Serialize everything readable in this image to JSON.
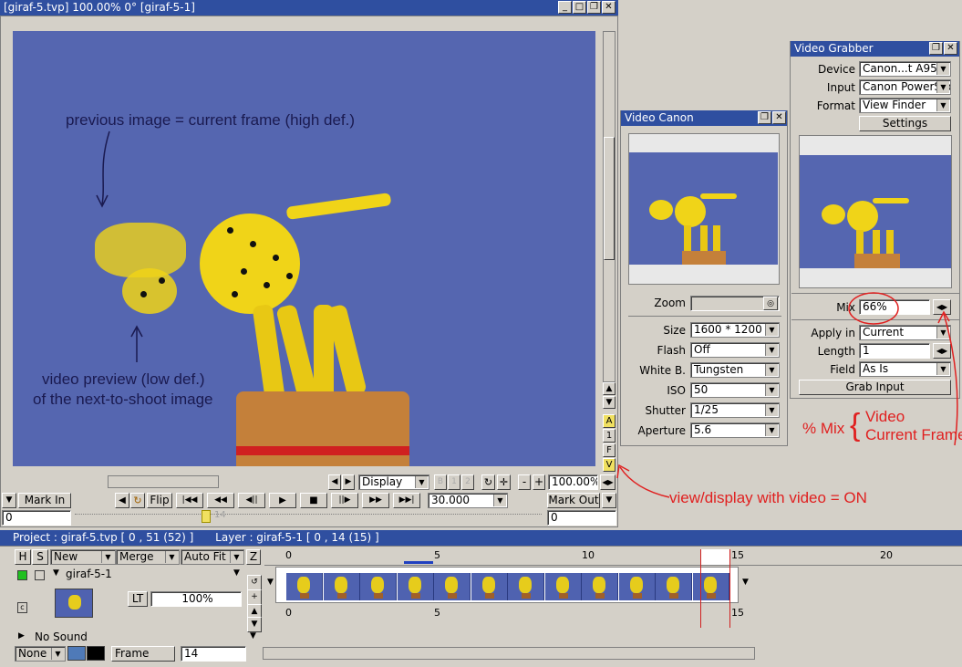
{
  "main_window": {
    "title": "[giraf-5.tvp]  100.00%   0°  [giraf-5-1]",
    "display_label": "Display",
    "zoom": "100.00%",
    "fps": "30.000",
    "mark_in_label": "Mark In",
    "mark_out_label": "Mark Out",
    "flip_label": "Flip",
    "mark_in_value": "0",
    "mark_out_value": "0",
    "current_frame_marker": "14",
    "side_buttons": [
      "A",
      "1",
      "F",
      "V"
    ]
  },
  "annotations": {
    "previous_image": "previous image = current frame (high def.)",
    "video_preview_line1": "video preview (low def.)",
    "video_preview_line2": "of the next-to-shoot image",
    "view_display": "view/display with video = ON",
    "mix_label": "% Mix",
    "brace": "{",
    "video_line1": "Video",
    "video_line2": "Current Frame"
  },
  "video_canon": {
    "title": "Video Canon",
    "zoom_label": "Zoom",
    "size_label": "Size",
    "size_value": "1600 * 1200",
    "flash_label": "Flash",
    "flash_value": "Off",
    "white_label": "White B.",
    "white_value": "Tungsten",
    "iso_label": "ISO",
    "iso_value": "50",
    "shutter_label": "Shutter",
    "shutter_value": "1/25",
    "aperture_label": "Aperture",
    "aperture_value": "5.6"
  },
  "video_grabber": {
    "title": "Video Grabber",
    "device_label": "Device",
    "device_value": "Canon...t A95",
    "input_label": "Input",
    "input_value": "Canon PowerSho",
    "format_label": "Format",
    "format_value": "View Finder",
    "settings_label": "Settings",
    "mix_label": "Mix",
    "mix_value": "66%",
    "apply_label": "Apply in",
    "apply_value": "Current",
    "length_label": "Length",
    "length_value": "1",
    "field_label": "Field",
    "field_value": "As Is",
    "grab_label": "Grab Input"
  },
  "timeline": {
    "project_info": "Project : giraf-5.tvp [ 0 , 51  (52) ]",
    "layer_info": "Layer : giraf-5-1 [ 0 , 14  (15) ]",
    "col_h": "H",
    "col_s": "S",
    "new_label": "New",
    "merge_label": "Merge",
    "autofit_label": "Auto Fit",
    "z_label": "Z",
    "layer_name": "giraf-5-1",
    "lt_label": "LT",
    "opacity": "100%",
    "no_sound": "No Sound",
    "none_label": "None",
    "frame_label": "Frame",
    "frame_value": "14",
    "ruler_top": [
      "0",
      "5",
      "10",
      "15",
      "20"
    ],
    "ruler_bottom": [
      "0",
      "5",
      "15"
    ]
  },
  "colors": {
    "titlebar": "#2f4fa0",
    "annotation_red": "#e02020",
    "annotation_dark": "#1a1a50",
    "sky": "#5566b0"
  }
}
